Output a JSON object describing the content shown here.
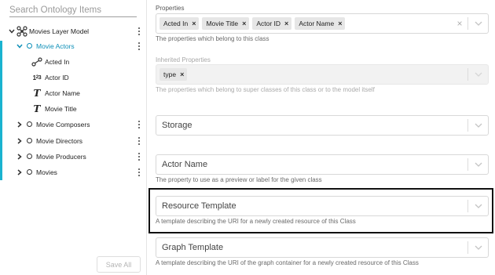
{
  "sidebar": {
    "search_placeholder": "Search Ontology Items",
    "root": {
      "label": "Movies Layer Model"
    },
    "selected_class": {
      "label": "Movie Actors",
      "properties": [
        {
          "label": "Acted In",
          "icon": "relation-icon"
        },
        {
          "label": "Actor ID",
          "icon": "number-icon"
        },
        {
          "label": "Actor Name",
          "icon": "text-icon"
        },
        {
          "label": "Movie Title",
          "icon": "text-icon"
        }
      ]
    },
    "classes": [
      {
        "label": "Movie Composers"
      },
      {
        "label": "Movie Directors"
      },
      {
        "label": "Movie Producers"
      },
      {
        "label": "Movies"
      }
    ],
    "save_all_label": "Save All",
    "accent_color": "#1ab3d0"
  },
  "form": {
    "properties": {
      "label": "Properties",
      "chips": [
        "Acted In",
        "Movie Title",
        "Actor ID",
        "Actor Name"
      ],
      "helper": "The properties which belong to this class"
    },
    "inherited": {
      "label": "Inherited Properties",
      "chips": [
        "type"
      ],
      "helper": "The properties which belong to super classes of this class or to the model itself"
    },
    "storage": {
      "placeholder": "Storage"
    },
    "preview_label": {
      "placeholder": "Actor Name",
      "helper": "The property to use as a preview or label for the given class"
    },
    "resource_template": {
      "placeholder": "Resource Template",
      "helper": "A template describing the URI for a newly created resource of this Class"
    },
    "graph_template": {
      "placeholder": "Graph Template",
      "helper": "A template describing the URI of the graph container for a newly created resource of this Class"
    }
  }
}
